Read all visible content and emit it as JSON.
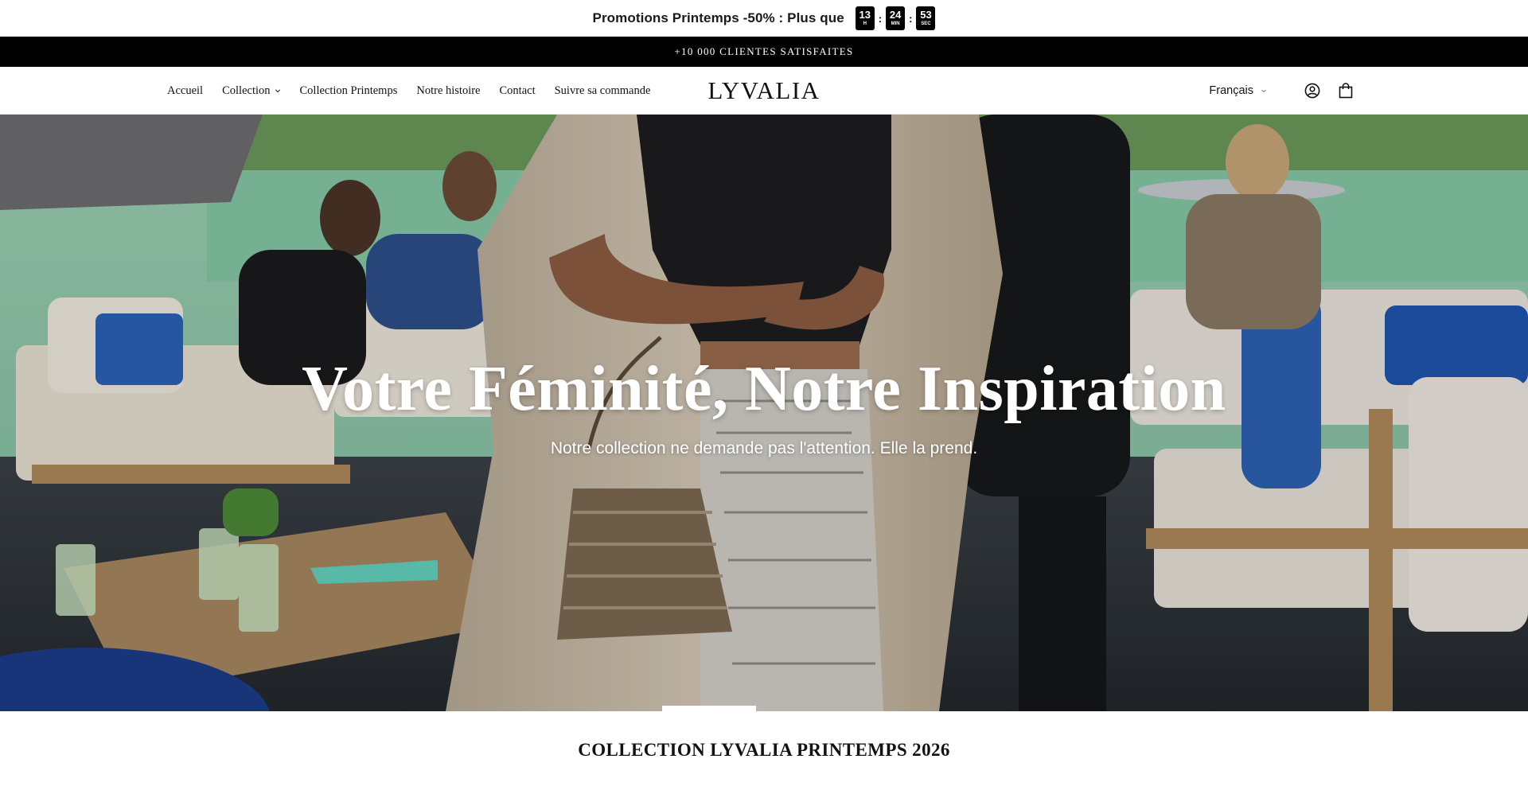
{
  "promo": {
    "text": "Promotions Printemps -50% : Plus que",
    "timer": [
      {
        "value": "13",
        "unit": "H"
      },
      {
        "value": "24",
        "unit": "MIN"
      },
      {
        "value": "53",
        "unit": "SEC"
      }
    ]
  },
  "announcement": "+10 000 CLIENTES SATISFAITES",
  "header": {
    "nav": [
      {
        "label": "Accueil",
        "has_dropdown": false
      },
      {
        "label": "Collection",
        "has_dropdown": true
      },
      {
        "label": "Collection Printemps",
        "has_dropdown": false
      },
      {
        "label": "Notre histoire",
        "has_dropdown": false
      },
      {
        "label": "Contact",
        "has_dropdown": false
      },
      {
        "label": "Suivre sa commande",
        "has_dropdown": false
      }
    ],
    "logo": "LYVALIA",
    "language": "Français",
    "icons": [
      "account-icon",
      "cart-icon"
    ]
  },
  "hero": {
    "title": "Votre Féminité, Notre Inspiration",
    "subtitle": "Notre collection ne demande pas l'attention. Elle la prend."
  },
  "section": {
    "title": "COLLECTION LYVALIA PRINTEMPS 2026"
  },
  "colors": {
    "announcement_bg": "#000000",
    "timer_bg": "#000000",
    "text": "#121212"
  }
}
